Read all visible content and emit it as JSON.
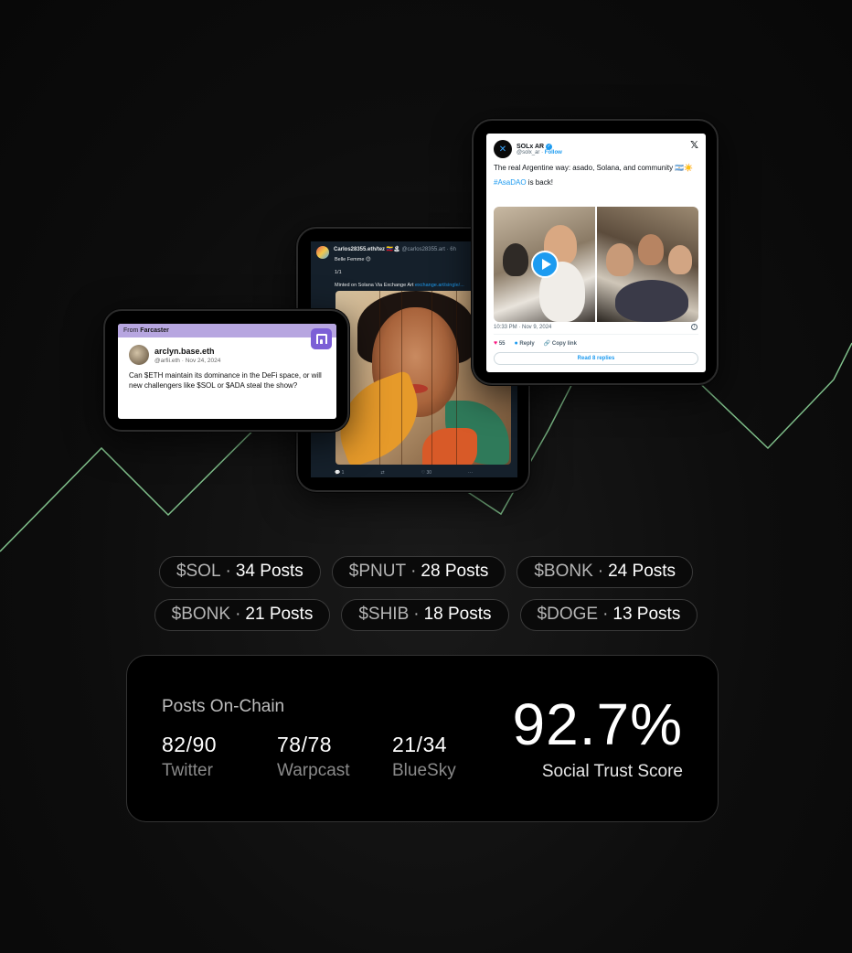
{
  "art_tweet": {
    "author": "Carlos28355.eth/tez 🇻🇪🏝",
    "handle": "@carlos28355.art · 6h",
    "line1": "Belle Femme 😊",
    "line2": "1/1",
    "line3": "Minted on Solana Via Exchange Art",
    "link": "exchange.art/single/...",
    "replies": "1",
    "likes": "30"
  },
  "farcaster": {
    "bar_prefix": "From",
    "bar_source": "Farcaster",
    "name": "arclyn.base.eth",
    "meta": "@arfii.eth · Nov 24, 2024",
    "text": "Can $ETH maintain its dominance in the DeFi space, or will new challengers like $SOL or $ADA steal the show?"
  },
  "x_tweet": {
    "name": "SOLx AR",
    "handle": "@solx_ar ·",
    "follow": "Follow",
    "text1": "The real Argentine way: asado, Solana, and community 🇦🇷☀️",
    "hashtag": "#AsaDAO",
    "text2": " is back!",
    "time": "10:33 PM · Nov 9, 2024",
    "likes": "55",
    "reply": "Reply",
    "copy": "Copy link",
    "read_replies": "Read 8 replies"
  },
  "pills": [
    {
      "ticker": "$SOL",
      "count": "34 Posts"
    },
    {
      "ticker": "$PNUT",
      "count": "28 Posts"
    },
    {
      "ticker": "$BONK",
      "count": "24 Posts"
    },
    {
      "ticker": "$BONK",
      "count": "21 Posts"
    },
    {
      "ticker": "$SHIB",
      "count": "18 Posts"
    },
    {
      "ticker": "$DOGE",
      "count": "13 Posts"
    }
  ],
  "stats": {
    "title": "Posts On-Chain",
    "twitter": {
      "value": "82/90",
      "label": "Twitter"
    },
    "warpcast": {
      "value": "78/78",
      "label": "Warpcast"
    },
    "bluesky": {
      "value": "21/34",
      "label": "BlueSky"
    },
    "score": "92.7%",
    "score_label": "Social Trust Score"
  },
  "colors": {
    "trend_line": "#7fbf8a",
    "farcaster_purple": "#7c5fd6",
    "twitter_blue": "#1d9bf0"
  }
}
